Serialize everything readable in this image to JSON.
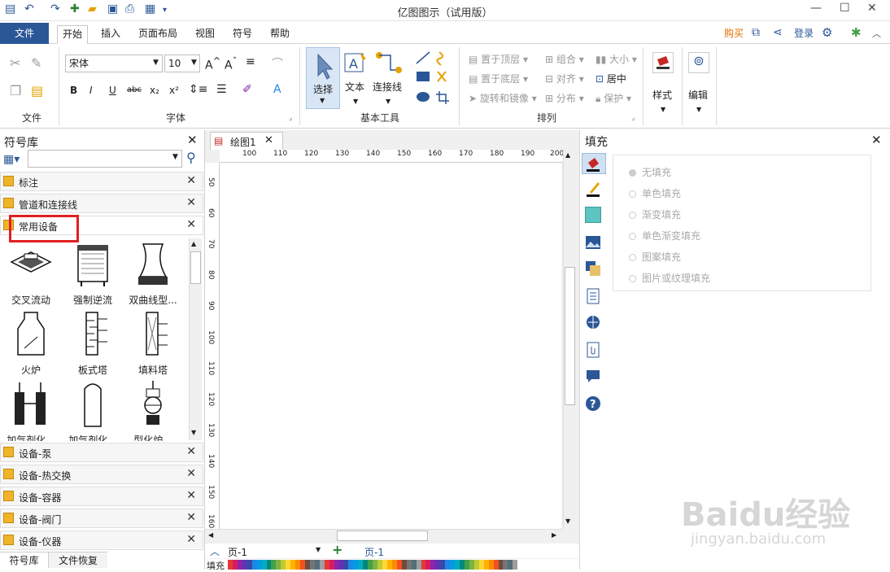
{
  "app_title": "亿图图示（试用版）",
  "menu": {
    "file": "文件",
    "tabs": [
      "开始",
      "插入",
      "页面布局",
      "视图",
      "符号",
      "帮助"
    ],
    "right": {
      "buy": "购买",
      "login": "登录"
    }
  },
  "ribbon": {
    "groups": {
      "file": "文件",
      "font": "字体",
      "basic_tools": "基本工具",
      "arrange": "排列"
    },
    "font_name": "宋体",
    "font_size": "10",
    "select_label": "选择",
    "text_label": "文本",
    "connector_label": "连接线",
    "arrange": {
      "bring_front": "置于顶层",
      "send_back": "置于底层",
      "rotate": "旋转和镜像",
      "group": "组合",
      "align": "对齐",
      "distribute": "分布",
      "size": "大小",
      "center": "居中",
      "protect": "保护"
    },
    "style_label": "样式",
    "edit_label": "编辑"
  },
  "library": {
    "title": "符号库",
    "search_placeholder": "",
    "top_rows": [
      "标注",
      "管道和连接线",
      "常用设备"
    ],
    "shapes": [
      [
        "交叉流动",
        "强制逆流",
        "双曲线型..."
      ],
      [
        "火炉",
        "板式塔",
        "填料塔"
      ],
      [
        "加气剂化...",
        "加气剂化...",
        "型化炉..."
      ]
    ],
    "bottom_rows": [
      "设备-泵",
      "设备-热交换",
      "设备-容器",
      "设备-阀门",
      "设备-仪器"
    ],
    "bottom_tabs": [
      "符号库",
      "文件恢复"
    ]
  },
  "canvas": {
    "doc_tab": "绘图1",
    "ruler_h": [
      "100",
      "110",
      "120",
      "130",
      "140",
      "150",
      "160",
      "170",
      "180",
      "190",
      "200"
    ],
    "ruler_v": [
      "50",
      "60",
      "70",
      "80",
      "90",
      "100",
      "110",
      "120",
      "130",
      "140",
      "150",
      "160"
    ],
    "page_selector": "页-1",
    "page_tab": "页-1",
    "fill_label": "填充"
  },
  "fill_panel": {
    "title": "填充",
    "options": [
      "无填充",
      "单色填充",
      "渐变填充",
      "单色渐变填充",
      "图案填充",
      "图片或纹理填充"
    ]
  },
  "watermark": {
    "line1": "Baidu经验",
    "line2": "jingyan.baidu.com"
  },
  "colors": {
    "accent": "#2b5797",
    "highlight": "#e02020",
    "palette": [
      "#e53935",
      "#d81b60",
      "#8e24aa",
      "#5e35b1",
      "#3949ab",
      "#1e88e5",
      "#039be5",
      "#00acc1",
      "#00897b",
      "#43a047",
      "#7cb342",
      "#c0ca33",
      "#fdd835",
      "#ffb300",
      "#fb8c00",
      "#f4511e",
      "#6d4c41",
      "#757575",
      "#546e7a",
      "#9e9e9e"
    ]
  }
}
